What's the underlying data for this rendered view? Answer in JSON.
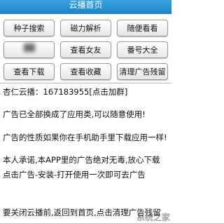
{
  "header": {
    "title": "云播首页"
  },
  "buttons": [
    {
      "label": "种子搜索",
      "name": "seed-search-button"
    },
    {
      "label": "磁力解析",
      "name": "magnet-parse-button"
    },
    {
      "label": "随便看看",
      "name": "random-watch-button"
    },
    {
      "label": "",
      "name": "blurred-button"
    },
    {
      "label": "查看女友",
      "name": "view-girlfriend-button"
    },
    {
      "label": "番号大全",
      "name": "code-list-button"
    },
    {
      "label": "查看下载",
      "name": "view-download-button"
    },
    {
      "label": "查看收藏",
      "name": "view-favorites-button"
    },
    {
      "label": "清理广告残留",
      "name": "clear-ads-button"
    }
  ],
  "content": {
    "qq_line": "杏仁云播：167183955[点击加群]",
    "line1": "广告已全部换成了应用类,可以随意使用!",
    "line2": "广告的性质如果你在手机助手里下载应用一样!",
    "line3": "本人承诺,本APP里的广告绝对无毒,放心下载",
    "line4": "点击广告-安装-打开使用一次即可去广告",
    "line5": "要关闭云播前,返回到首页,点击清理广告残留"
  },
  "watermark": "系统之家"
}
